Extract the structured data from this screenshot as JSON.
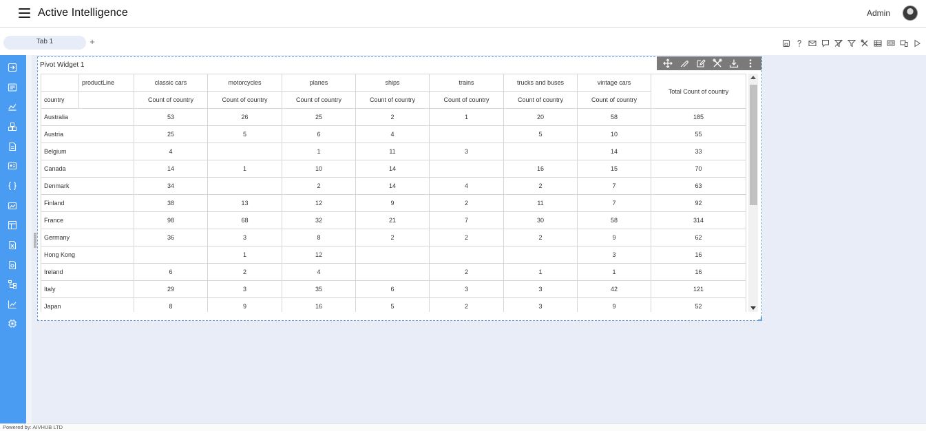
{
  "header": {
    "title": "Active Intelligence",
    "user": "Admin"
  },
  "tabs": {
    "items": [
      {
        "label": "Tab 1",
        "active": true
      }
    ],
    "add_label": "+"
  },
  "toolbar_icons": [
    "save-icon",
    "help-icon",
    "email-icon",
    "comment-icon",
    "clear-filter-icon",
    "filter-icon",
    "tools-icon",
    "table-icon",
    "screen-icon",
    "devices-icon",
    "play-icon"
  ],
  "sidebar_icons": [
    "exit-icon",
    "list-icon",
    "chart-line-icon",
    "cubes-icon",
    "report-icon",
    "id-card-icon",
    "code-braces-icon",
    "image-chart-icon",
    "dashboard-icon",
    "excel-icon",
    "document-icon",
    "hierarchy-icon",
    "trend-icon",
    "chip-icon"
  ],
  "widget": {
    "title": "Pivot Widget 1",
    "toolbar_icons": [
      "move-icon",
      "link-icon",
      "edit-icon",
      "settings-tools-icon",
      "download-icon",
      "more-vertical-icon"
    ]
  },
  "pivot": {
    "column_field": "productLine",
    "row_field": "country",
    "columns": [
      "classic cars",
      "motorcycles",
      "planes",
      "ships",
      "trains",
      "trucks and buses",
      "vintage cars"
    ],
    "measure": "Count of country",
    "total_label": "Total Count of country",
    "rows": [
      {
        "label": "Australia",
        "values": [
          "53",
          "26",
          "25",
          "2",
          "1",
          "20",
          "58"
        ],
        "total": "185"
      },
      {
        "label": "Austria",
        "values": [
          "25",
          "5",
          "6",
          "4",
          "",
          "5",
          "10"
        ],
        "total": "55"
      },
      {
        "label": "Belgium",
        "values": [
          "4",
          "",
          "1",
          "11",
          "3",
          "",
          "14"
        ],
        "total": "33"
      },
      {
        "label": "Canada",
        "values": [
          "14",
          "1",
          "10",
          "14",
          "",
          "16",
          "15"
        ],
        "total": "70"
      },
      {
        "label": "Denmark",
        "values": [
          "34",
          "",
          "2",
          "14",
          "4",
          "2",
          "7"
        ],
        "total": "63"
      },
      {
        "label": "Finland",
        "values": [
          "38",
          "13",
          "12",
          "9",
          "2",
          "11",
          "7"
        ],
        "total": "92"
      },
      {
        "label": "France",
        "values": [
          "98",
          "68",
          "32",
          "21",
          "7",
          "30",
          "58"
        ],
        "total": "314"
      },
      {
        "label": "Germany",
        "values": [
          "36",
          "3",
          "8",
          "2",
          "2",
          "2",
          "9"
        ],
        "total": "62"
      },
      {
        "label": "Hong Kong",
        "values": [
          "",
          "1",
          "12",
          "",
          "",
          "",
          "3"
        ],
        "total": "16"
      },
      {
        "label": "Ireland",
        "values": [
          "6",
          "2",
          "4",
          "",
          "2",
          "1",
          "1"
        ],
        "total": "16"
      },
      {
        "label": "Italy",
        "values": [
          "29",
          "3",
          "35",
          "6",
          "3",
          "3",
          "42"
        ],
        "total": "121"
      },
      {
        "label": "Japan",
        "values": [
          "8",
          "9",
          "16",
          "5",
          "2",
          "3",
          "9"
        ],
        "total": "52"
      }
    ]
  },
  "footer": {
    "text": "Powered by: AIVHUB LTD"
  },
  "colors": {
    "sidebar": "#4a9cf2",
    "canvas": "#e8edf7",
    "widget_toolbar": "#7a7a7a",
    "tab_bg": "#e6edf8"
  }
}
